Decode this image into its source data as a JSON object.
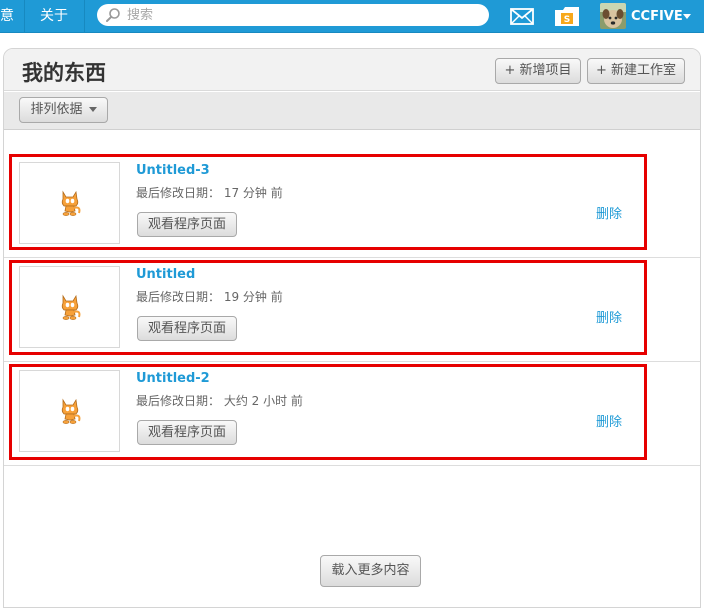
{
  "nav": {
    "partial_left": "意",
    "about": "关于",
    "search_placeholder": "搜索",
    "username": "CCFIVE"
  },
  "page": {
    "title": "我的东西",
    "new_project_button": "+ 新增项目",
    "new_studio_button": "+ 新建工作室",
    "sort_button": "排列依据"
  },
  "projects": [
    {
      "title": "Untitled-3",
      "modified": "最后修改日期： 17 分钟 前",
      "view_button": "观看程序页面",
      "delete": "删除"
    },
    {
      "title": "Untitled",
      "modified": "最后修改日期： 19 分钟 前",
      "view_button": "观看程序页面",
      "delete": "删除"
    },
    {
      "title": "Untitled-2",
      "modified": "最后修改日期： 大约 2 小时 前",
      "view_button": "观看程序页面",
      "delete": "删除"
    }
  ],
  "load_more": "载入更多内容",
  "colors": {
    "nav_bar": "#1f9ad6",
    "link": "#1f9ad6",
    "highlight": "#e60000"
  }
}
